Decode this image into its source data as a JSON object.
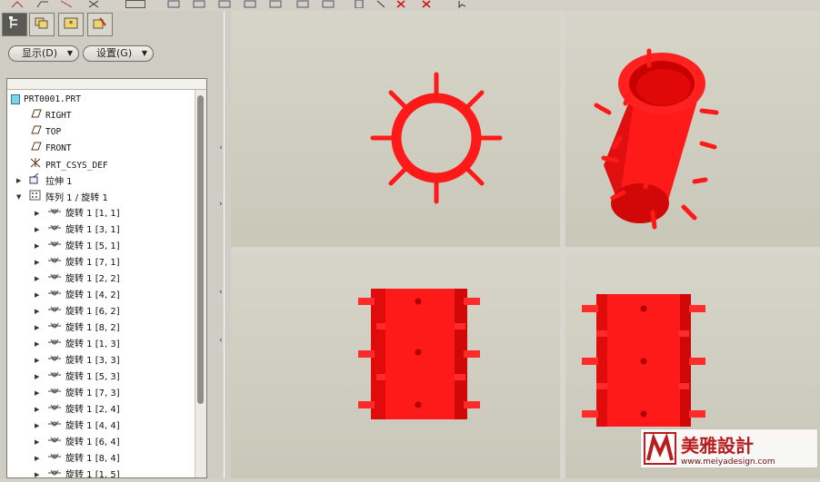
{
  "toolbar": {
    "icons": [
      "sketch-icon",
      "plane-icon",
      "axis-icon",
      "point-icon",
      "csys-icon",
      "view-icon",
      "zoom-icon",
      "repaint-icon",
      "orient-icon",
      "model-icon",
      "delete-icon",
      "delete-all-icon",
      "cursor-icon"
    ]
  },
  "panel": {
    "tabs": [
      {
        "name": "model-tree-tab",
        "icon": "tree-icon",
        "active": true
      },
      {
        "name": "folder-tab",
        "icon": "folder-icon",
        "active": false
      },
      {
        "name": "favorites-tab",
        "icon": "star-icon",
        "active": false
      },
      {
        "name": "connections-tab",
        "icon": "connection-icon",
        "active": false
      }
    ],
    "show_label": "显示(D)",
    "settings_label": "设置(G)"
  },
  "tree": {
    "root": "PRT0001.PRT",
    "planes": [
      "RIGHT",
      "TOP",
      "FRONT"
    ],
    "csys": "PRT_CSYS_DEF",
    "extrude": "拉伸 1",
    "pattern": "阵列 1 / 旋转 1",
    "members": [
      "旋转 1 [1, 1]",
      "旋转 1 [3, 1]",
      "旋转 1 [5, 1]",
      "旋转 1 [7, 1]",
      "旋转 1 [2, 2]",
      "旋转 1 [4, 2]",
      "旋转 1 [6, 2]",
      "旋转 1 [8, 2]",
      "旋转 1 [1, 3]",
      "旋转 1 [3, 3]",
      "旋转 1 [5, 3]",
      "旋转 1 [7, 3]",
      "旋转 1 [2, 4]",
      "旋转 1 [4, 4]",
      "旋转 1 [6, 4]",
      "旋转 1 [8, 4]",
      "旋转 1 [1, 5]"
    ]
  },
  "views": {
    "top": "top-view",
    "iso": "iso-view",
    "front": "front-view",
    "side": "side-view"
  },
  "watermark": {
    "brand": "美雅設計",
    "url": "www.meiyadesign.com",
    "model_color": "#ff1a1a"
  }
}
